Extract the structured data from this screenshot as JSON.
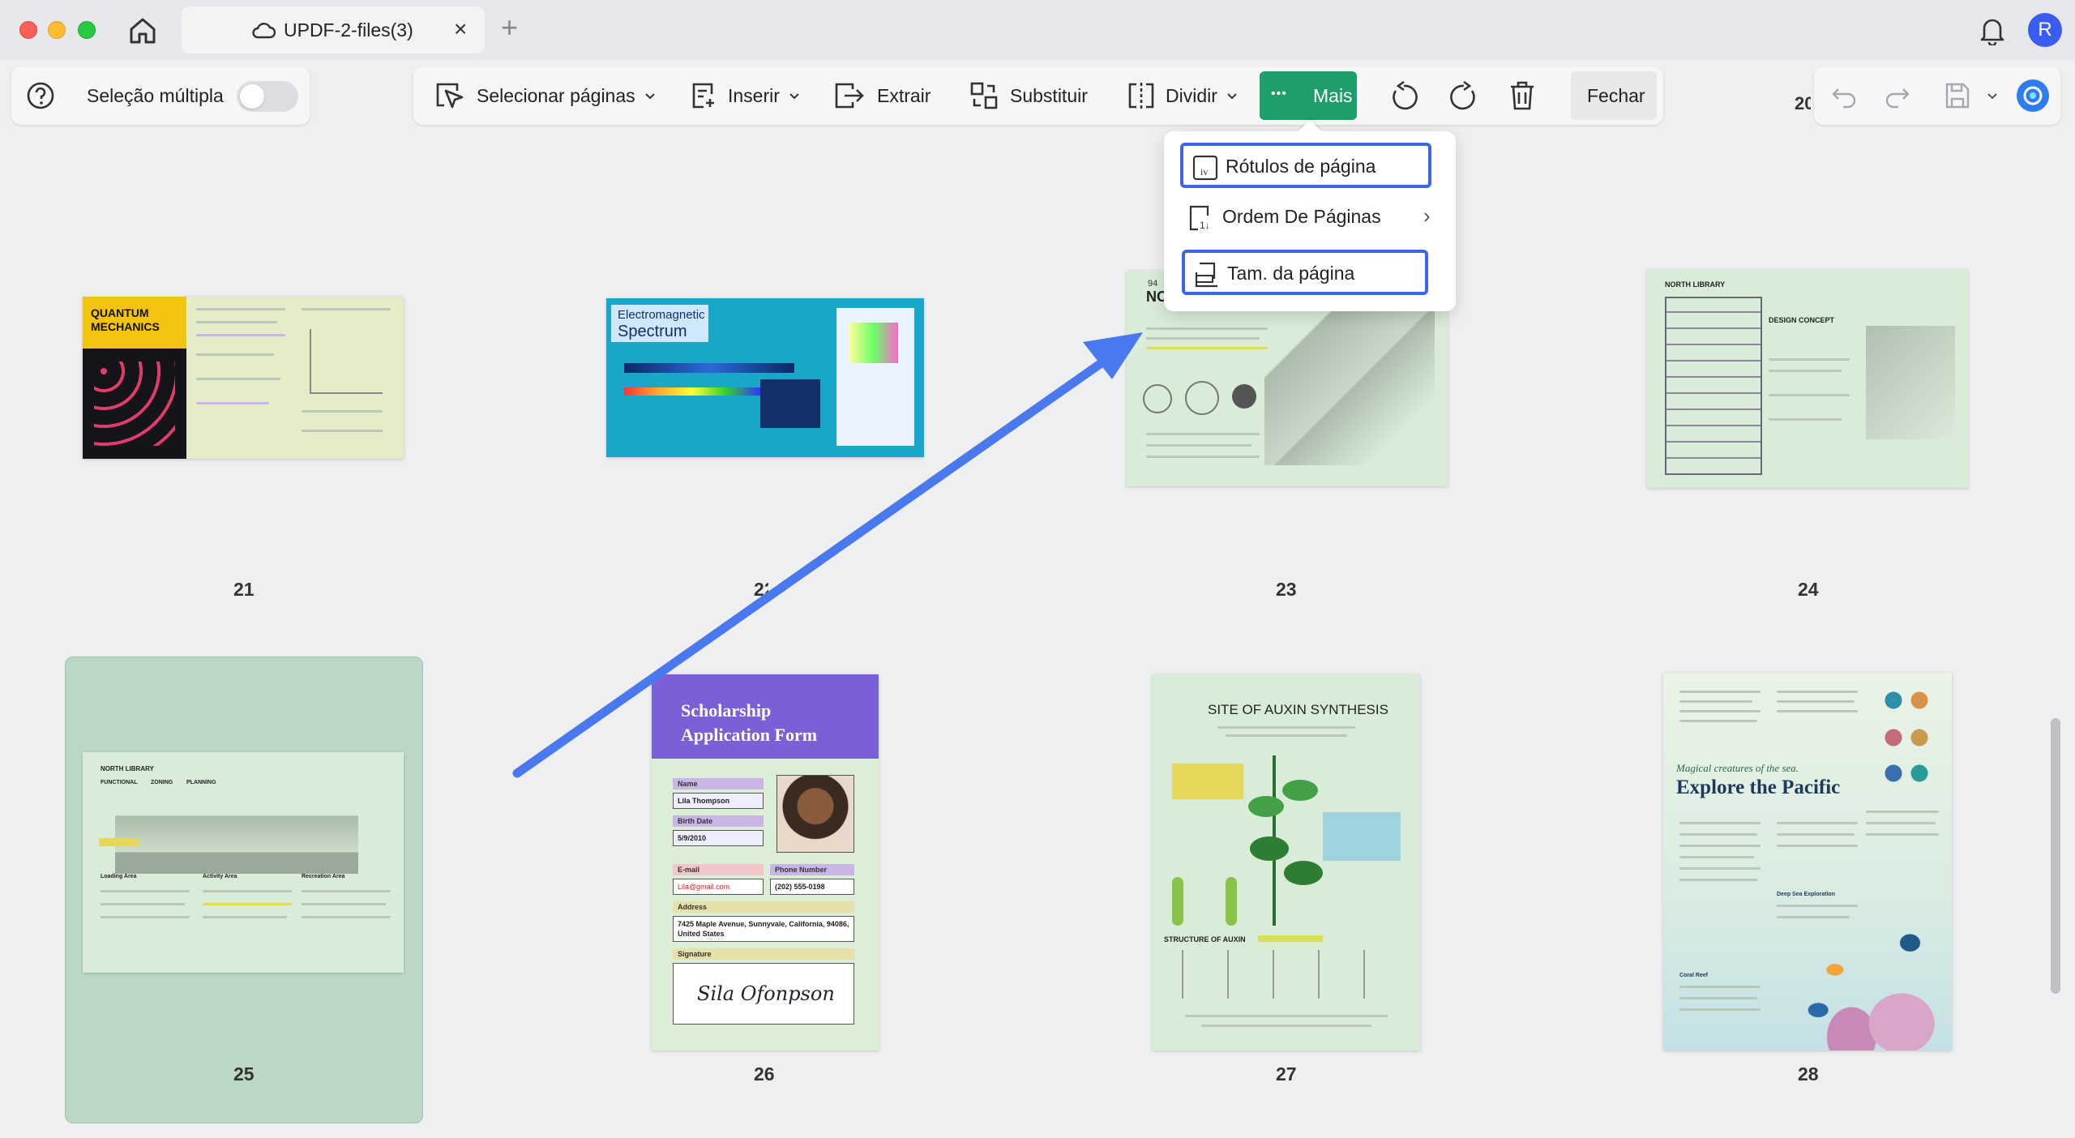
{
  "window": {
    "tab_title": "UPDF-2-files(3)",
    "tab_close": "×",
    "new_tab": "+",
    "avatar_letter": "R"
  },
  "toolbar_left": {
    "help": "?",
    "multi_select_label": "Seleção múltipla",
    "multi_select_on": false
  },
  "toolbar": {
    "select_pages": "Selecionar páginas",
    "insert": "Inserir",
    "extract": "Extrair",
    "replace": "Substituir",
    "split": "Dividir",
    "more": "Mais",
    "more_dots": "•••",
    "close": "Fechar",
    "partial_page_indicator": "20"
  },
  "more_menu": {
    "items": [
      {
        "label": "Rótulos de página",
        "icon_glyph": "iv"
      },
      {
        "label": "Ordem De Páginas",
        "icon_glyph": "1↓"
      },
      {
        "label": "Tam. da página"
      }
    ],
    "submenu_chevron": "›"
  },
  "pages": [
    {
      "number": "21",
      "title": "QUANTUM MECHANICS"
    },
    {
      "number": "22",
      "title": "Electromagnetic",
      "subtitle": "Spectrum"
    },
    {
      "number": "23",
      "title": "NO",
      "page_label": "94"
    },
    {
      "number": "24",
      "title": "NORTH LIBRARY",
      "subtitle": "DESIGN CONCEPT"
    },
    {
      "number": "25",
      "title": "NORTH LIBRARY",
      "headings": [
        "FUNCTIONAL",
        "ZONING",
        "PLANNING"
      ],
      "columns": [
        "Loading Area",
        "Activity Area",
        "Recreation Area"
      ]
    },
    {
      "number": "26",
      "title": "Scholarship Application Form",
      "fields": [
        {
          "label": "Name",
          "value": "Lila Thompson"
        },
        {
          "label": "Birth Date",
          "value": "5/9/2010"
        },
        {
          "label": "E-mail",
          "value": "Lila@gmail.com"
        },
        {
          "label": "Phone Number",
          "value": "(202) 555-0198"
        },
        {
          "label": "Address",
          "value": "7425 Maple Avenue, Sunnyvale, California, 94086, United States"
        },
        {
          "label": "Signature",
          "value": "Sila Ofonpson"
        }
      ]
    },
    {
      "number": "27",
      "title": "SITE OF AUXIN SYNTHESIS",
      "subtitle": "STRUCTURE OF AUXIN"
    },
    {
      "number": "28",
      "title": "Explore the Pacific",
      "subtitle": "Magical creatures of the sea.",
      "headings": [
        "Deep Sea Exploration",
        "Coral Reef"
      ]
    }
  ],
  "colors": {
    "accent_green": "#1e9e6a",
    "highlight_blue": "#3f63e8",
    "arrow_blue": "#4a78ef",
    "avatar_blue": "#3a5cf0",
    "thumb_bg": "#d8ecd8",
    "scholarship_header": "#7b5fd6"
  },
  "icons": [
    "home-icon",
    "cloud-icon",
    "bell-icon",
    "help-icon",
    "select-pages-icon",
    "insert-icon",
    "extract-icon",
    "replace-icon",
    "split-icon",
    "rotate-left-icon",
    "rotate-right-icon",
    "trash-icon",
    "undo-icon",
    "redo-icon",
    "save-icon",
    "ai-assistant-icon"
  ]
}
